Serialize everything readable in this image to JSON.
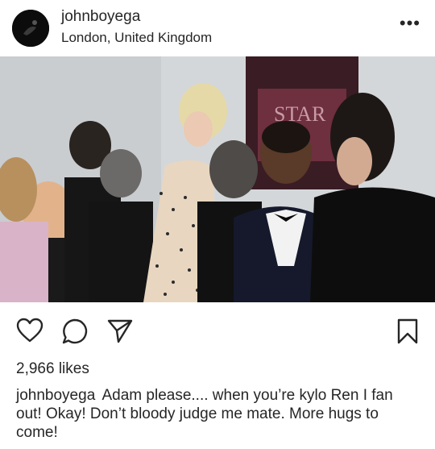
{
  "post": {
    "username": "johnboyega",
    "location": "London, United Kingdom",
    "more_label": "•••",
    "likes": "2,966 likes",
    "caption_user": "johnboyega",
    "caption_text": "Adam please.... when you’re kylo Ren I fan out! Okay! Don’t bloody judge me mate. More hugs to come!",
    "poster_text": "STAR"
  },
  "icons": {
    "like": "heart-icon",
    "comment": "comment-icon",
    "share": "paper-plane-icon",
    "save": "bookmark-icon"
  }
}
